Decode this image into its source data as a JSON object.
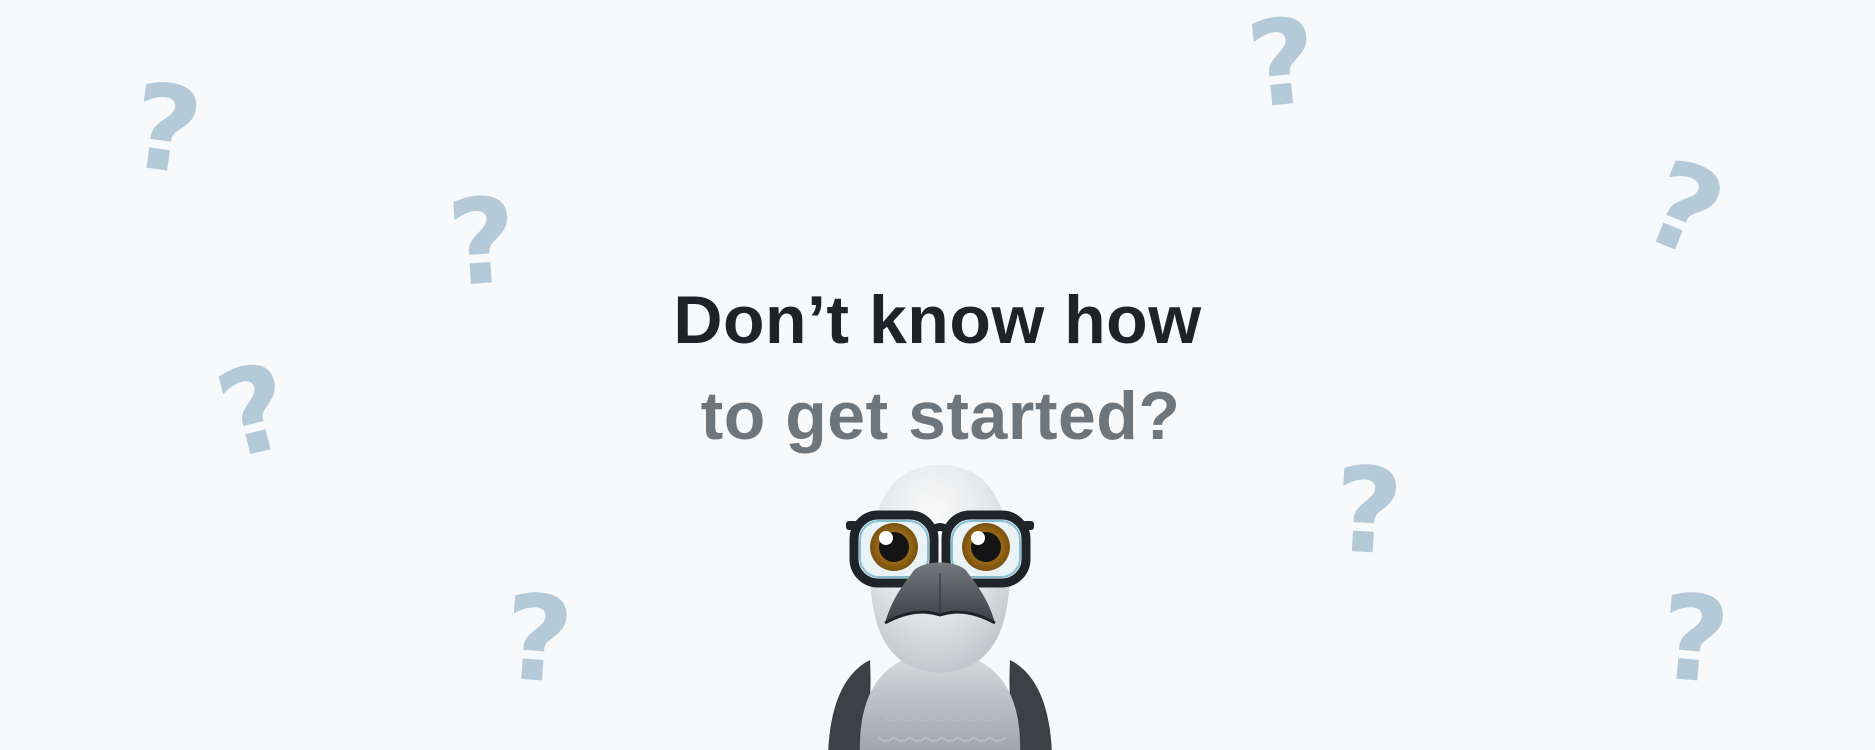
{
  "headline": {
    "line1": "Don’t know how",
    "line2": "to get started?"
  },
  "decorations": {
    "question_mark": "?",
    "color": "#b4cad9"
  },
  "mascot": {
    "icon": "bird-with-glasses-icon"
  },
  "colors": {
    "background": "#f7f9fb",
    "headline_primary": "#1f2226",
    "headline_secondary": "#6d767d"
  }
}
